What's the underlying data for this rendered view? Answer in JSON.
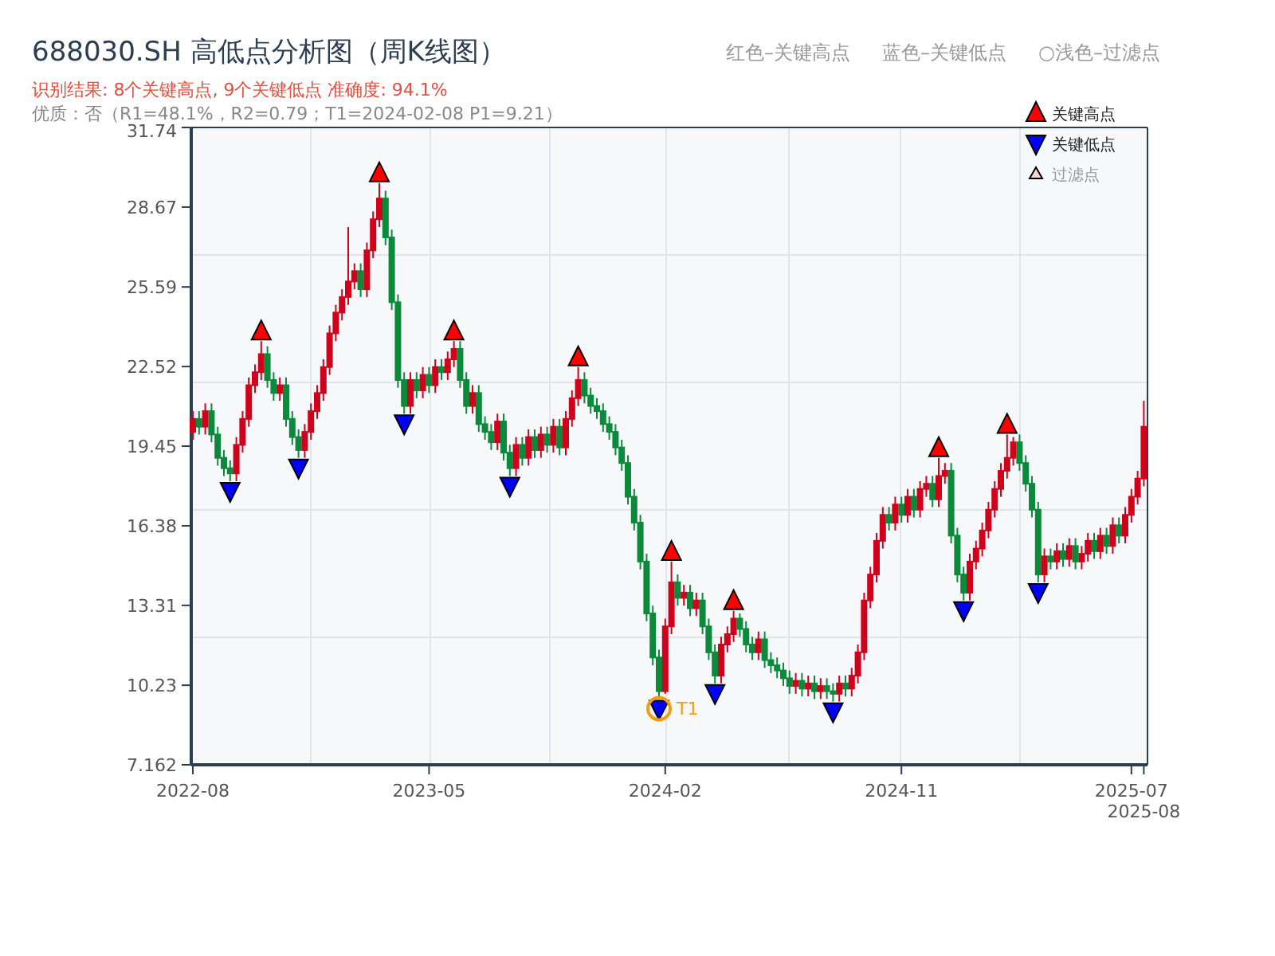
{
  "title": "688030.SH 高低点分析图（周K线图）",
  "color_notes": [
    "红色–关键高点",
    "蓝色–关键低点",
    "○浅色–过滤点"
  ],
  "result_line": "识别结果: 8个关键高点, 9个关键低点   准确度: 94.1%",
  "quality_line": "优质：否（R1=48.1%，R2=0.79；T1=2024-02-08 P1=9.21）",
  "chart": {
    "legend": [
      {
        "kind": "high",
        "label": "关键高点"
      },
      {
        "kind": "low",
        "label": "关键低点"
      },
      {
        "kind": "filtered",
        "label": "过滤点"
      }
    ],
    "chart_data": {
      "type": "candlestick",
      "ylim": [
        7.162,
        31.74
      ],
      "yticks": [
        31.74,
        28.67,
        25.59,
        22.52,
        19.45,
        16.38,
        13.31,
        10.23,
        7.162
      ],
      "categories": [
        "2022-08",
        null,
        null,
        null,
        null,
        null,
        null,
        null,
        null,
        null,
        null,
        null,
        null,
        null,
        null,
        null,
        null,
        null,
        null,
        null,
        null,
        null,
        null,
        null,
        null,
        null,
        null,
        null,
        null,
        null,
        null,
        null,
        null,
        null,
        null,
        null,
        null,
        null,
        "2023-05",
        null,
        null,
        null,
        null,
        null,
        null,
        null,
        null,
        null,
        null,
        null,
        null,
        null,
        null,
        null,
        null,
        null,
        null,
        null,
        null,
        null,
        null,
        null,
        null,
        null,
        null,
        null,
        null,
        null,
        null,
        null,
        null,
        null,
        null,
        null,
        null,
        null,
        "2024-02",
        null,
        null,
        null,
        null,
        null,
        null,
        null,
        null,
        null,
        null,
        null,
        null,
        null,
        null,
        null,
        null,
        null,
        null,
        null,
        null,
        null,
        null,
        null,
        null,
        null,
        null,
        null,
        null,
        null,
        null,
        null,
        null,
        null,
        null,
        null,
        null,
        null,
        "2024-11",
        null,
        null,
        null,
        null,
        null,
        null,
        null,
        null,
        null,
        null,
        null,
        null,
        null,
        null,
        null,
        null,
        null,
        null,
        null,
        null,
        null,
        null,
        null,
        null,
        null,
        null,
        null,
        null,
        null,
        null,
        null,
        null,
        null,
        null,
        null,
        null,
        "2025-07",
        null,
        "2025-08"
      ],
      "ohlc": [
        [
          20.0,
          20.8,
          19.7,
          20.5
        ],
        [
          20.5,
          20.8,
          19.9,
          20.2
        ],
        [
          20.2,
          21.1,
          19.9,
          20.8
        ],
        [
          20.8,
          21.1,
          19.6,
          19.9
        ],
        [
          19.9,
          20.2,
          18.7,
          19.0
        ],
        [
          19.0,
          19.3,
          18.3,
          18.6
        ],
        [
          18.6,
          18.9,
          18.1,
          18.4
        ],
        [
          18.4,
          19.8,
          18.1,
          19.5
        ],
        [
          19.5,
          20.8,
          19.2,
          20.5
        ],
        [
          20.5,
          22.1,
          20.2,
          21.8
        ],
        [
          21.8,
          22.6,
          21.5,
          22.3
        ],
        [
          22.3,
          23.5,
          22.0,
          23.0
        ],
        [
          23.0,
          23.3,
          21.7,
          22.0
        ],
        [
          22.0,
          22.3,
          21.2,
          21.5
        ],
        [
          21.5,
          22.1,
          21.2,
          21.8
        ],
        [
          21.8,
          22.1,
          20.2,
          20.5
        ],
        [
          20.5,
          20.8,
          19.5,
          19.8
        ],
        [
          19.8,
          20.1,
          19.0,
          19.3
        ],
        [
          19.3,
          20.3,
          19.0,
          20.0
        ],
        [
          20.0,
          21.1,
          19.7,
          20.8
        ],
        [
          20.8,
          21.8,
          20.5,
          21.5
        ],
        [
          21.5,
          22.8,
          21.2,
          22.5
        ],
        [
          22.5,
          24.1,
          22.2,
          23.8
        ],
        [
          23.8,
          24.9,
          23.5,
          24.6
        ],
        [
          24.6,
          25.5,
          24.3,
          25.2
        ],
        [
          25.2,
          27.9,
          24.9,
          25.8
        ],
        [
          25.8,
          26.5,
          25.5,
          26.2
        ],
        [
          26.2,
          26.5,
          25.2,
          25.5
        ],
        [
          25.5,
          27.3,
          25.2,
          27.0
        ],
        [
          27.0,
          28.5,
          26.7,
          28.2
        ],
        [
          28.2,
          29.6,
          27.9,
          29.0
        ],
        [
          29.0,
          29.3,
          27.2,
          27.5
        ],
        [
          27.5,
          27.8,
          24.7,
          25.0
        ],
        [
          25.0,
          25.3,
          21.7,
          22.0
        ],
        [
          22.0,
          22.3,
          20.7,
          21.0
        ],
        [
          21.0,
          22.3,
          20.7,
          22.0
        ],
        [
          22.0,
          22.3,
          21.3,
          21.6
        ],
        [
          21.6,
          22.5,
          21.3,
          22.2
        ],
        [
          22.2,
          22.5,
          21.5,
          21.8
        ],
        [
          21.8,
          22.8,
          21.5,
          22.5
        ],
        [
          22.5,
          22.8,
          22.0,
          22.3
        ],
        [
          22.3,
          23.1,
          22.0,
          22.8
        ],
        [
          22.8,
          23.5,
          22.5,
          23.2
        ],
        [
          23.2,
          23.5,
          21.7,
          22.0
        ],
        [
          22.0,
          22.3,
          20.7,
          21.0
        ],
        [
          21.0,
          21.8,
          20.7,
          21.5
        ],
        [
          21.5,
          21.8,
          20.0,
          20.3
        ],
        [
          20.3,
          20.6,
          19.7,
          20.0
        ],
        [
          20.0,
          20.3,
          19.3,
          19.6
        ],
        [
          19.6,
          20.7,
          19.3,
          20.4
        ],
        [
          20.4,
          20.7,
          18.9,
          19.2
        ],
        [
          19.2,
          19.5,
          18.3,
          18.6
        ],
        [
          18.6,
          19.8,
          18.3,
          19.5
        ],
        [
          19.5,
          19.8,
          18.7,
          19.0
        ],
        [
          19.0,
          20.1,
          18.7,
          19.8
        ],
        [
          19.8,
          20.1,
          19.0,
          19.3
        ],
        [
          19.3,
          20.2,
          19.0,
          19.9
        ],
        [
          19.9,
          20.2,
          19.2,
          19.5
        ],
        [
          19.5,
          20.5,
          19.2,
          20.2
        ],
        [
          20.2,
          20.5,
          19.1,
          19.4
        ],
        [
          19.4,
          20.8,
          19.1,
          20.5
        ],
        [
          20.5,
          21.6,
          20.2,
          21.3
        ],
        [
          21.3,
          22.5,
          21.0,
          22.0
        ],
        [
          22.0,
          22.3,
          21.1,
          21.4
        ],
        [
          21.4,
          21.7,
          20.7,
          21.0
        ],
        [
          21.0,
          21.3,
          20.5,
          20.8
        ],
        [
          20.8,
          21.1,
          20.0,
          20.3
        ],
        [
          20.3,
          20.6,
          19.7,
          20.0
        ],
        [
          20.0,
          20.3,
          19.1,
          19.4
        ],
        [
          19.4,
          19.7,
          18.5,
          18.8
        ],
        [
          18.8,
          19.1,
          17.2,
          17.5
        ],
        [
          17.5,
          17.8,
          16.2,
          16.5
        ],
        [
          16.5,
          16.8,
          14.7,
          15.0
        ],
        [
          15.0,
          15.3,
          12.7,
          13.0
        ],
        [
          13.0,
          13.3,
          11.0,
          11.3
        ],
        [
          11.3,
          11.6,
          9.7,
          10.0
        ],
        [
          10.0,
          12.8,
          9.9,
          12.5
        ],
        [
          12.5,
          15.0,
          12.2,
          14.2
        ],
        [
          14.2,
          14.5,
          13.3,
          13.6
        ],
        [
          13.6,
          14.1,
          13.3,
          13.8
        ],
        [
          13.8,
          14.1,
          12.9,
          13.2
        ],
        [
          13.2,
          13.8,
          12.9,
          13.5
        ],
        [
          13.5,
          13.8,
          12.2,
          12.5
        ],
        [
          12.5,
          12.8,
          11.2,
          11.5
        ],
        [
          11.5,
          11.8,
          10.3,
          10.6
        ],
        [
          10.6,
          12.1,
          10.3,
          11.8
        ],
        [
          11.8,
          12.5,
          11.5,
          12.2
        ],
        [
          12.2,
          13.1,
          11.9,
          12.8
        ],
        [
          12.8,
          13.0,
          12.1,
          12.4
        ],
        [
          12.4,
          12.7,
          11.5,
          11.8
        ],
        [
          11.8,
          12.1,
          11.2,
          11.5
        ],
        [
          11.5,
          12.3,
          11.2,
          12.0
        ],
        [
          12.0,
          12.3,
          10.9,
          11.2
        ],
        [
          11.2,
          11.5,
          10.7,
          11.0
        ],
        [
          11.0,
          11.3,
          10.5,
          10.8
        ],
        [
          10.8,
          11.1,
          10.2,
          10.5
        ],
        [
          10.5,
          10.8,
          9.9,
          10.2
        ],
        [
          10.2,
          10.7,
          9.9,
          10.4
        ],
        [
          10.4,
          10.7,
          9.8,
          10.1
        ],
        [
          10.1,
          10.6,
          9.8,
          10.3
        ],
        [
          10.3,
          10.6,
          9.7,
          10.0
        ],
        [
          10.0,
          10.5,
          9.7,
          10.2
        ],
        [
          10.2,
          10.5,
          9.7,
          10.0
        ],
        [
          10.0,
          10.3,
          9.6,
          9.9
        ],
        [
          9.9,
          10.6,
          9.6,
          10.3
        ],
        [
          10.3,
          10.6,
          9.8,
          10.1
        ],
        [
          10.1,
          10.9,
          9.8,
          10.6
        ],
        [
          10.6,
          11.8,
          10.3,
          11.5
        ],
        [
          11.5,
          13.8,
          11.2,
          13.5
        ],
        [
          13.5,
          14.8,
          13.2,
          14.5
        ],
        [
          14.5,
          16.1,
          14.2,
          15.8
        ],
        [
          15.8,
          17.1,
          15.5,
          16.8
        ],
        [
          16.8,
          17.1,
          16.2,
          16.5
        ],
        [
          16.5,
          17.5,
          16.2,
          17.2
        ],
        [
          17.2,
          17.5,
          16.5,
          16.8
        ],
        [
          16.8,
          17.8,
          16.5,
          17.5
        ],
        [
          17.5,
          17.8,
          16.7,
          17.0
        ],
        [
          17.0,
          18.1,
          16.7,
          17.8
        ],
        [
          17.8,
          18.3,
          17.5,
          18.0
        ],
        [
          18.0,
          18.3,
          17.1,
          17.4
        ],
        [
          17.4,
          19.0,
          17.1,
          18.3
        ],
        [
          18.3,
          18.8,
          18.0,
          18.5
        ],
        [
          18.5,
          18.8,
          15.7,
          16.0
        ],
        [
          16.0,
          16.3,
          14.2,
          14.5
        ],
        [
          14.5,
          14.8,
          13.5,
          13.8
        ],
        [
          13.8,
          15.3,
          13.5,
          15.0
        ],
        [
          15.0,
          15.8,
          14.7,
          15.5
        ],
        [
          15.5,
          16.5,
          15.2,
          16.2
        ],
        [
          16.2,
          17.3,
          15.9,
          17.0
        ],
        [
          17.0,
          18.1,
          16.7,
          17.8
        ],
        [
          17.8,
          18.8,
          17.5,
          18.5
        ],
        [
          18.5,
          19.9,
          18.2,
          19.0
        ],
        [
          19.0,
          19.8,
          18.7,
          19.6
        ],
        [
          19.6,
          19.9,
          18.5,
          18.8
        ],
        [
          18.8,
          19.1,
          17.7,
          18.0
        ],
        [
          18.0,
          18.3,
          16.7,
          17.0
        ],
        [
          17.0,
          17.3,
          14.2,
          14.5
        ],
        [
          14.5,
          15.5,
          14.2,
          15.2
        ],
        [
          15.2,
          15.5,
          14.7,
          15.0
        ],
        [
          15.0,
          15.7,
          14.7,
          15.4
        ],
        [
          15.4,
          15.7,
          14.8,
          15.1
        ],
        [
          15.1,
          15.9,
          14.8,
          15.6
        ],
        [
          15.6,
          15.9,
          14.7,
          15.0
        ],
        [
          15.0,
          15.6,
          14.7,
          15.3
        ],
        [
          15.3,
          16.1,
          15.0,
          15.8
        ],
        [
          15.8,
          16.1,
          15.1,
          15.4
        ],
        [
          15.4,
          16.3,
          15.1,
          16.0
        ],
        [
          16.0,
          16.3,
          15.3,
          15.6
        ],
        [
          15.6,
          16.7,
          15.3,
          16.4
        ],
        [
          16.4,
          16.7,
          15.7,
          16.0
        ],
        [
          16.0,
          17.1,
          15.7,
          16.8
        ],
        [
          16.8,
          17.8,
          16.5,
          17.5
        ],
        [
          17.5,
          18.5,
          17.2,
          18.2
        ],
        [
          18.2,
          21.2,
          17.9,
          20.2
        ]
      ],
      "annotations": [
        "T1"
      ]
    }
  }
}
